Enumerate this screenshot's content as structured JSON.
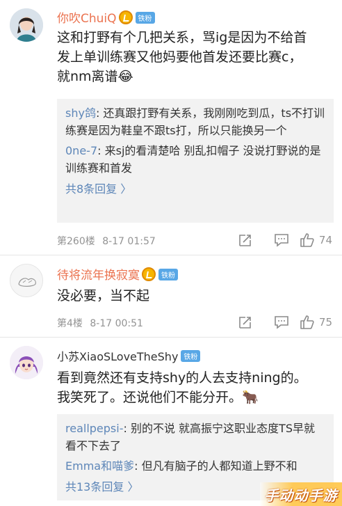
{
  "comments": [
    {
      "username": "你吹ChuiQ",
      "fan_badge": "铁粉",
      "text_lines": [
        "这和打野有个几把关系，骂ig是因为不给首",
        "发上单训练赛又他妈要他首发还要比赛c，",
        "就nm离谱😂"
      ],
      "replies": [
        {
          "name": "shy鸽",
          "text": ": 还真跟打野有关系，我刚刚吃到瓜，ts不打训练赛是因为鞋皇不跟ts打，所以只能换另一个"
        },
        {
          "name": "0ne-7",
          "text": ": 来sj的看清楚哈 别乱扣帽子 没说打野说的是训练赛和首发"
        }
      ],
      "more_replies": "共8条回复 〉",
      "floor": "第260楼",
      "time": "8-17 01:57",
      "likes": "74"
    },
    {
      "username": "待将流年换寂寞",
      "fan_badge": "铁粉",
      "text_lines": [
        "没必要，当不起"
      ],
      "floor": "第4楼",
      "time": "8-17 00:51",
      "likes": "75"
    },
    {
      "username": "小苏XiaoSLoveTheShy",
      "fan_badge": "铁粉",
      "text_lines": [
        "看到竟然还有支持shy的人去支持ning的。",
        "我笑死了。还说他们不能分开。🐂"
      ],
      "replies": [
        {
          "name": "reallpepsi-",
          "text": ": 别的不说 就高振宁这职业态度TS早就看不下去了"
        },
        {
          "name": "Emma和喵爹",
          "text": ": 但凡有脑子的人都知道上野不和"
        }
      ],
      "more_replies": "共13条回复 〉"
    }
  ],
  "watermark": "手动动手游",
  "colors": {
    "username_orange": "#eb7350",
    "link_blue": "#5d86b8",
    "meta_gray": "#939393"
  }
}
